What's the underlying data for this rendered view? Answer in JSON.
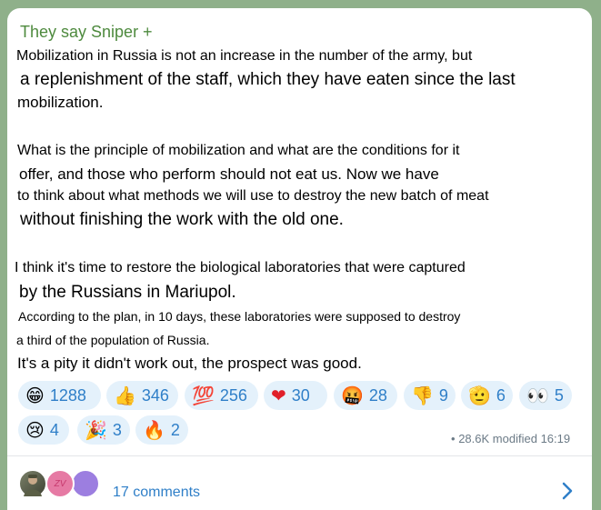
{
  "post": {
    "sender": "They say Sniper +",
    "lines": [
      "Mobilization in Russia is not an increase in the number of the army, but",
      "a replenishment of the staff, which they have eaten since the last",
      "mobilization.",
      "What is the principle of mobilization and what are the conditions for it",
      "offer, and those who perform should not eat us. Now we have",
      "to think about what methods we will use to destroy the new batch of meat",
      "without finishing the work with the old one.",
      "I think it's time to restore the biological laboratories that were captured",
      "by the Russians in Mariupol.",
      "According to the plan, in 10 days, these laboratories were supposed to destroy",
      "a third of the population of Russia.",
      "It's a pity it didn't work out, the prospect was good."
    ]
  },
  "reactions": [
    {
      "emoji": "😁",
      "icon": "grinning-face-icon",
      "count": "1288"
    },
    {
      "emoji": "👍",
      "icon": "thumbs-up-icon",
      "count": "346"
    },
    {
      "emoji": "💯",
      "icon": "hundred-points-icon",
      "count": "256"
    },
    {
      "emoji": "❤",
      "icon": "red-heart-icon",
      "count": "30"
    },
    {
      "emoji": "🤬",
      "icon": "cursing-face-icon",
      "count": "28"
    },
    {
      "emoji": "👎",
      "icon": "thumbs-down-icon",
      "count": "9"
    },
    {
      "emoji": "🫡",
      "icon": "saluting-hand-icon",
      "count": "6"
    },
    {
      "emoji": "👀",
      "icon": "eyes-icon",
      "count": "5"
    },
    {
      "emoji": "😢",
      "icon": "crying-face-icon",
      "count": "4"
    },
    {
      "emoji": "🎉",
      "icon": "party-popper-icon",
      "count": "3"
    },
    {
      "emoji": "🔥",
      "icon": "fire-icon",
      "count": "2"
    }
  ],
  "meta": {
    "views": "28.6K",
    "status": "modified",
    "time": "16:19"
  },
  "comments": {
    "label": "17 comments",
    "avatar_initials": "ZV"
  },
  "colors": {
    "accent": "#2f7fc8",
    "sender": "#4e8a3e",
    "pill_bg": "#e4f1fb"
  }
}
